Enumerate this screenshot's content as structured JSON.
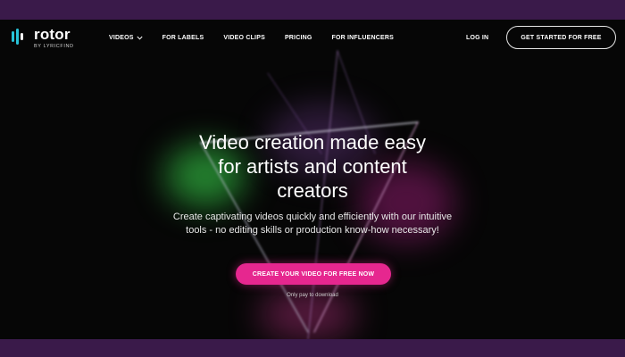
{
  "colors": {
    "frame": "#3a1a4a",
    "background": "#060606",
    "accent": "#e6278f",
    "logo_accent": "#27c3d8",
    "text": "#ffffff"
  },
  "logo": {
    "name": "rotor",
    "subtitle": "BY LYRICFIND",
    "icon": "rotor-logo-icon"
  },
  "nav": {
    "items": [
      {
        "label": "VIDEOS",
        "has_dropdown": true,
        "icon": "chevron-down-icon"
      },
      {
        "label": "FOR LABELS"
      },
      {
        "label": "VIDEO CLIPS"
      },
      {
        "label": "PRICING"
      },
      {
        "label": "FOR INFLUENCERS"
      }
    ],
    "login": "LOG IN",
    "cta": "GET STARTED FOR FREE"
  },
  "hero": {
    "title": "Video creation made easy\nfor artists and content\ncreators",
    "subtitle": "Create captivating videos quickly and efficiently with our intuitive\ntools - no editing skills or production know-how necessary!",
    "cta": "CREATE YOUR VIDEO FOR FREE NOW",
    "note": "Only pay to download"
  }
}
